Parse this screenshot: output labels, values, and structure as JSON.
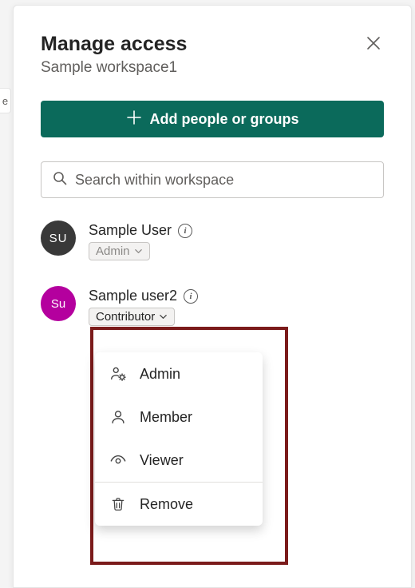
{
  "header": {
    "title": "Manage access",
    "subtitle": "Sample workspace1"
  },
  "addButton": {
    "label": "Add people or groups"
  },
  "search": {
    "placeholder": "Search within workspace"
  },
  "users": [
    {
      "initials": "SU",
      "name": "Sample User",
      "role": "Admin"
    },
    {
      "initials": "Su",
      "name": "Sample user2",
      "role": "Contributor"
    }
  ],
  "dropdown": {
    "admin": "Admin",
    "member": "Member",
    "viewer": "Viewer",
    "remove": "Remove"
  },
  "peek": "e"
}
